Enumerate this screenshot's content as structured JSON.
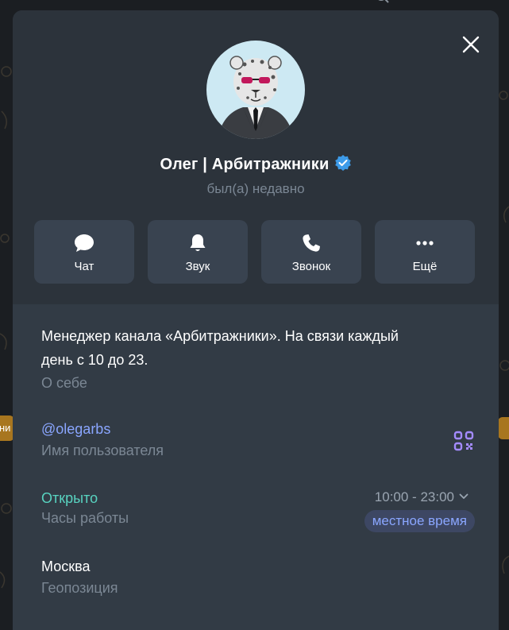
{
  "background": {
    "left_tab_text": "ни"
  },
  "profile": {
    "name": "Олег | Арбитражники",
    "status": "был(а) недавно",
    "verified": true
  },
  "actions": [
    {
      "label": "Чат",
      "icon": "chat-bubble-icon"
    },
    {
      "label": "Звук",
      "icon": "bell-icon"
    },
    {
      "label": "Звонок",
      "icon": "phone-icon"
    },
    {
      "label": "Ещё",
      "icon": "more-dots-icon"
    }
  ],
  "bio": {
    "line1": "Менеджер канала «Арбитражники». На связи каждый",
    "line2": "день с 10 до 23.",
    "label": "О себе"
  },
  "username": {
    "value": "@olegarbs",
    "label": "Имя пользователя"
  },
  "hours": {
    "status": "Открыто",
    "label": "Часы работы",
    "range": "10:00 - 23:00",
    "timezone_toggle": "местное время"
  },
  "location": {
    "value": "Москва",
    "label": "Геопозиция"
  },
  "colors": {
    "panel": "#323b45",
    "header": "#2c333b",
    "accent": "#8aa6ff",
    "open": "#58d3c0",
    "muted": "#7b8794",
    "verified": "#3d9be9"
  }
}
